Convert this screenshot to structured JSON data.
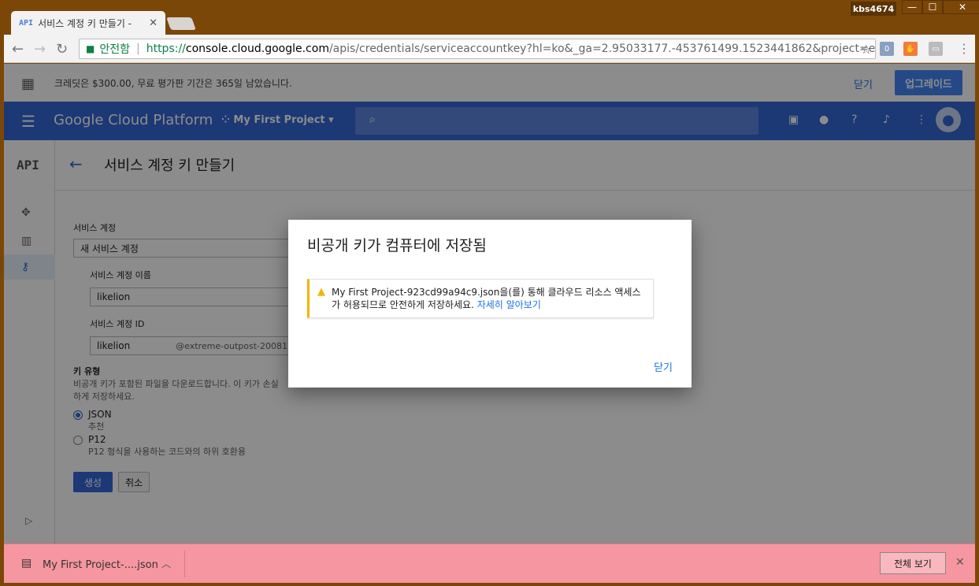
{
  "window": {
    "tab_title": "서비스 계정 키 만들기 -",
    "tab_favicon": "API",
    "user_badge": "kbs4674"
  },
  "addressbar": {
    "secure_label": "안전함",
    "url_protocol": "https://",
    "url_host": "console.cloud.google.com",
    "url_rest": "/apis/credentials/serviceaccountkey?hl=ko&_ga=2.95033177.-453761499.1523441862&project=extreme-..."
  },
  "promo": {
    "text": "크레딧은 $300.00, 무료 평가판 기간은 365일 남았습니다.",
    "close_label": "닫기",
    "upgrade_label": "업그레이드"
  },
  "appbar": {
    "brand": "Google Cloud Platform",
    "project": "My First Project"
  },
  "sidebar": {
    "logo": "API"
  },
  "page": {
    "title": "서비스 계정 키 만들기"
  },
  "form": {
    "service_account_label": "서비스 계정",
    "service_account_value": "새 서비스 계정",
    "name_label": "서비스 계정 이름",
    "name_value": "likelion",
    "id_label": "서비스 계정 ID",
    "id_value": "likelion",
    "id_suffix": "@extreme-outpost-20081",
    "key_type_label": "키 유형",
    "key_type_desc1": "비공개 키가 포함된 파일을 다운로드합니다. 이 키가 손실",
    "key_type_desc2": "하게 저장하세요.",
    "json_label": "JSON",
    "json_sub": "추천",
    "p12_label": "P12",
    "p12_sub": "P12 형식을 사용하는 코드와의 하위 호환용",
    "create_label": "생성",
    "cancel_label": "취소"
  },
  "dialog": {
    "title": "비공개 키가 컴퓨터에 저장됨",
    "notice_line1": "My First Project-923cd99a94c9.json을(를) 통해 클라우드 리소스 액세스",
    "notice_line2": "가 허용되므로 안전하게 저장하세요.",
    "notice_link": "자세히 알아보기",
    "close_label": "닫기"
  },
  "downloads": {
    "file_name": "My First Project-....json",
    "show_all_label": "전체 보기"
  }
}
